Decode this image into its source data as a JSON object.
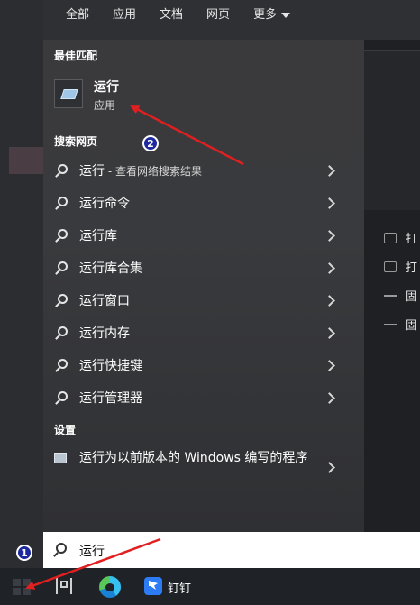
{
  "filters": {
    "tabs": [
      "全部",
      "应用",
      "文档",
      "网页"
    ],
    "more_label": "更多"
  },
  "best_match": {
    "heading": "最佳匹配",
    "app_name": "运行",
    "app_type": "应用",
    "icon": "run-app-icon"
  },
  "web_search": {
    "heading": "搜索网页",
    "items": [
      {
        "label": "运行",
        "sub": " - 查看网络搜索结果"
      },
      {
        "label": "运行命令",
        "sub": ""
      },
      {
        "label": "运行库",
        "sub": ""
      },
      {
        "label": "运行库合集",
        "sub": ""
      },
      {
        "label": "运行窗口",
        "sub": ""
      },
      {
        "label": "运行内存",
        "sub": ""
      },
      {
        "label": "运行快捷键",
        "sub": ""
      },
      {
        "label": "运行管理器",
        "sub": ""
      }
    ]
  },
  "settings": {
    "heading": "设置",
    "item_label": "运行为以前版本的 Windows 编写的程序"
  },
  "right_panel": {
    "rows": [
      "打",
      "打",
      "固",
      "固"
    ]
  },
  "search_box": {
    "value": "运行"
  },
  "taskbar": {
    "dingtalk_label": "钉钉"
  },
  "annotations": {
    "badge_1": "1",
    "badge_2": "2",
    "arrow_color": "#e02020"
  }
}
